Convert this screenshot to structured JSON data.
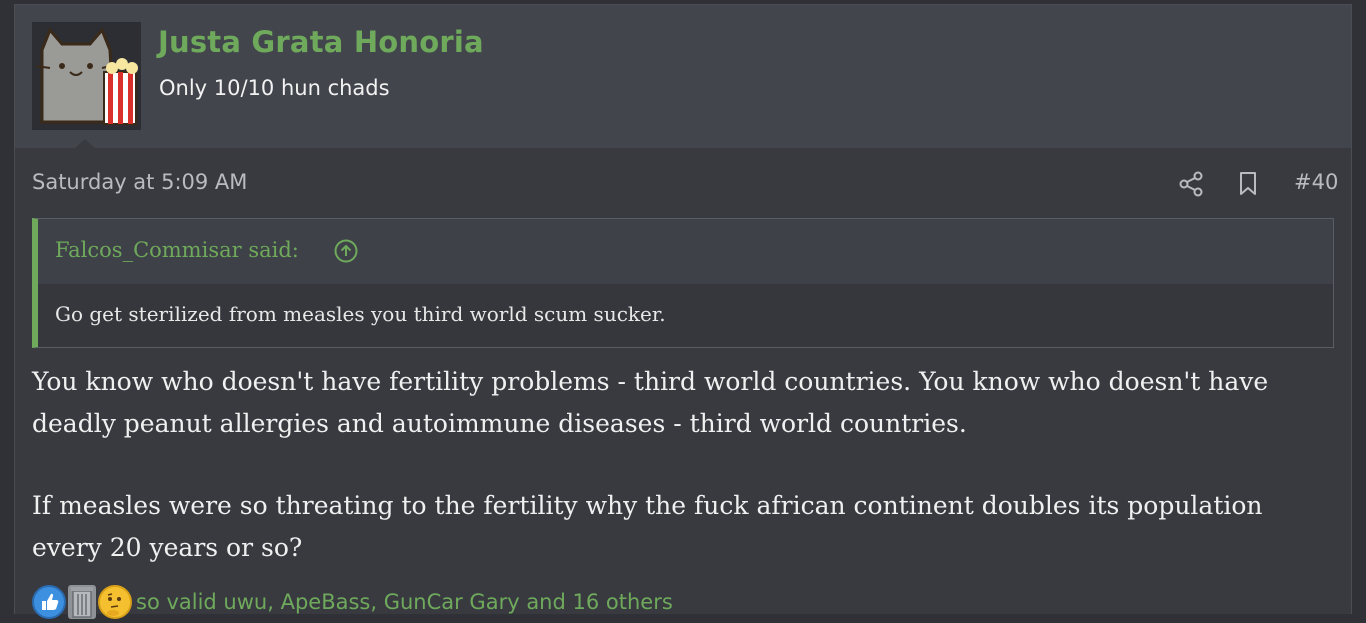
{
  "user": {
    "name": "Justa Grata Honoria",
    "title": "Only 10/10 hun chads"
  },
  "post": {
    "timestamp": "Saturday at 5:09 AM",
    "number": "#40",
    "quote": {
      "author": "Falcos_Commisar said:",
      "text": "Go get sterilized from measles you third world scum sucker."
    },
    "paragraphs": [
      "You know who doesn't have fertility problems - third world countries. You know who doesn't have deadly peanut allergies and autoimmune diseases - third world countries.",
      "If measles were so threating to the fertility why the fuck african continent doubles its population every 20 years or so?"
    ],
    "reactions": {
      "icons": [
        "like-icon",
        "trash-icon",
        "thinking-icon"
      ],
      "summary": "so valid uwu, ApeBass, GunCar Gary and 16 others"
    }
  },
  "colors": {
    "accent": "#6faa5c",
    "background": "#383a40",
    "header": "#42454c"
  }
}
